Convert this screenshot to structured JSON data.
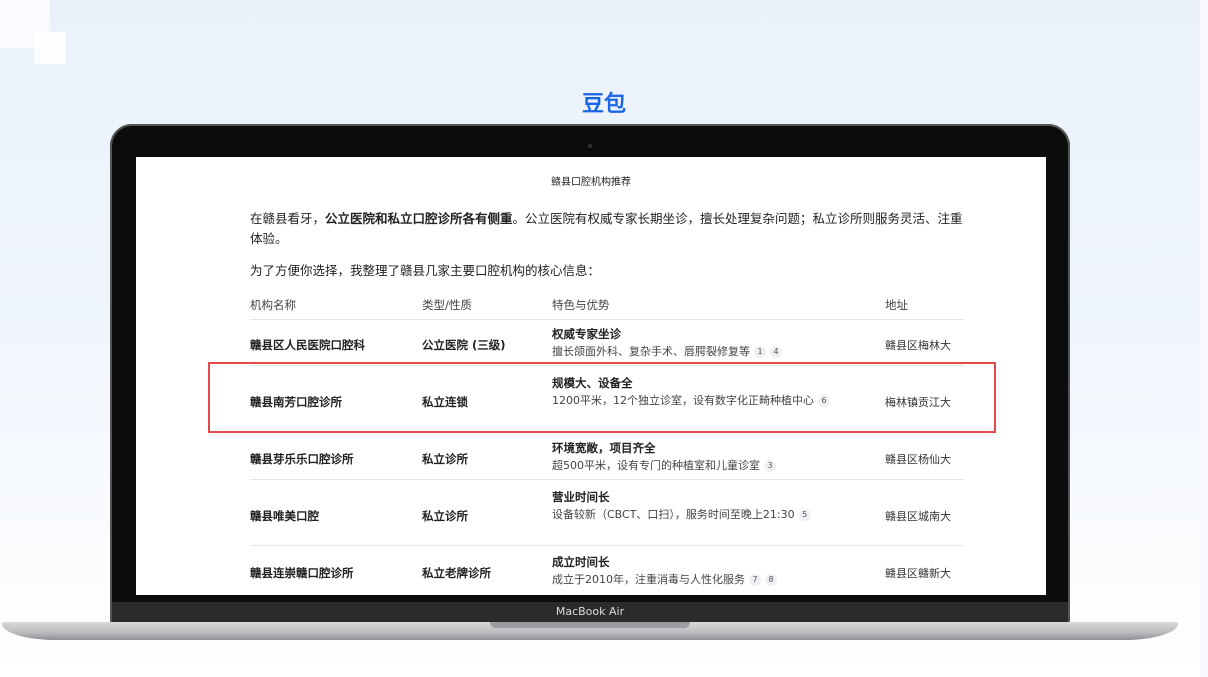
{
  "brand_title": "豆包",
  "device_label": "MacBook Air",
  "page": {
    "title": "赣县口腔机构推荐",
    "intro_pre": "在赣县看牙，",
    "intro_bold": "公立医院和私立口腔诊所各有侧重",
    "intro_post": "。公立医院有权威专家长期坐诊，擅长处理复杂问题；私立诊所则服务灵活、注重体验。",
    "intro2": "为了方便你选择，我整理了赣县几家主要口腔机构的核心信息："
  },
  "table": {
    "headers": [
      "机构名称",
      "类型/性质",
      "特色与优势",
      "地址"
    ],
    "rows": [
      {
        "name": "赣县区人民医院口腔科",
        "type": "公立医院 (三级)",
        "feat_title": "权威专家坐诊",
        "feat_desc": "擅长颌面外科、复杂手术、唇腭裂修复等",
        "cites": [
          "1",
          "4"
        ],
        "address": "赣县区梅林大"
      },
      {
        "name": "赣县南芳口腔诊所",
        "type": "私立连锁",
        "feat_title": "规模大、设备全",
        "feat_desc": "1200平米，12个独立诊室，设有数字化正畸种植中心",
        "cites": [
          "6"
        ],
        "address": "梅林镇贡江大"
      },
      {
        "name": "赣县芽乐乐口腔诊所",
        "type": "私立诊所",
        "feat_title": "环境宽敞，项目齐全",
        "feat_desc": "超500平米，设有专门的种植室和儿童诊室",
        "cites": [
          "3"
        ],
        "address": "赣县区杨仙大"
      },
      {
        "name": "赣县唯美口腔",
        "type": "私立诊所",
        "feat_title": "营业时间长",
        "feat_desc": "设备较新（CBCT、口扫），服务时间至晚上21:30",
        "cites": [
          "5"
        ],
        "address": "赣县区城南大"
      },
      {
        "name": "赣县连崇赣口腔诊所",
        "type": "私立老牌诊所",
        "feat_title": "成立时间长",
        "feat_desc": "成立于2010年，注重消毒与人性化服务",
        "cites": [
          "7",
          "8"
        ],
        "address": "赣县区赣新大"
      }
    ]
  },
  "colors": {
    "brand": "#1a66e6",
    "highlight": "#e2494a"
  }
}
